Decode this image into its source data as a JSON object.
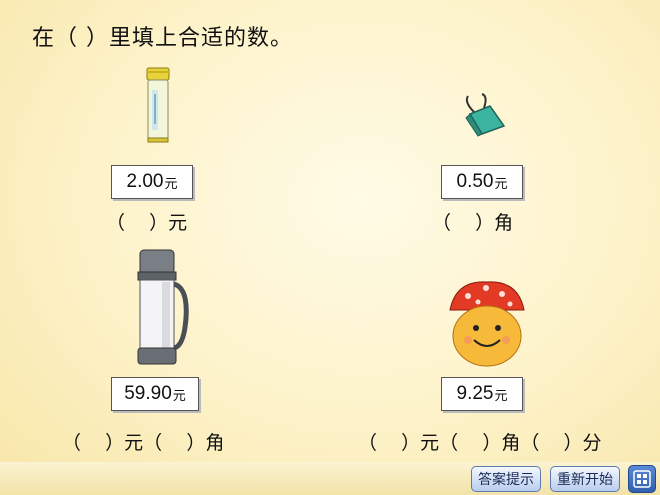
{
  "title": "在（  ）里填上合适的数。",
  "items": [
    {
      "name": "glue-stick",
      "price": "2.00",
      "unit": "元",
      "blank": "（    ）元"
    },
    {
      "name": "binder-clip",
      "price": "0.50",
      "unit": "元",
      "blank": "（    ）角"
    },
    {
      "name": "thermos",
      "price": "59.90",
      "unit": "元",
      "blank": "（    ）元（    ）角"
    },
    {
      "name": "mushroom-toy",
      "price": "9.25",
      "unit": "元",
      "blank": "（    ）元（    ）角（    ）分"
    }
  ],
  "buttons": {
    "hint": "答案提示",
    "restart": "重新开始"
  },
  "icons": {
    "menu": "grid-menu-icon"
  }
}
